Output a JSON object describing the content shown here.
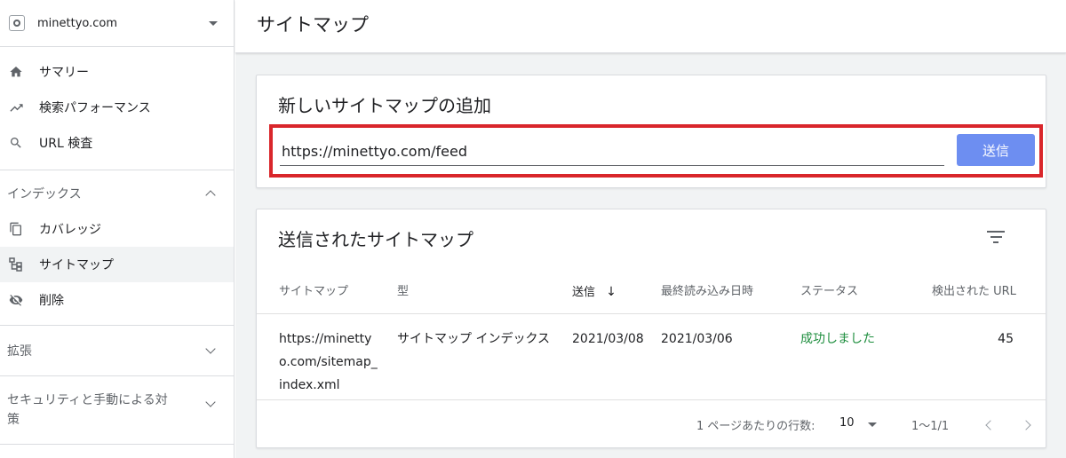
{
  "property": {
    "name": "minettyo.com"
  },
  "nav": {
    "items": [
      {
        "label": "サマリー",
        "icon": "home-icon"
      },
      {
        "label": "検索パフォーマンス",
        "icon": "trending-up-icon"
      },
      {
        "label": "URL 検査",
        "icon": "search-icon"
      }
    ],
    "index_group": {
      "label": "インデックス",
      "items": [
        {
          "label": "カバレッジ",
          "icon": "file-copy-icon"
        },
        {
          "label": "サイトマップ",
          "icon": "sitemap-icon"
        },
        {
          "label": "削除",
          "icon": "visibility-off-icon"
        }
      ]
    },
    "enhancements_group": {
      "label": "拡張"
    },
    "security_group": {
      "label": "セキュリティと手動による対策"
    }
  },
  "page": {
    "title": "サイトマップ"
  },
  "add_card": {
    "title": "新しいサイトマップの追加",
    "input_value": "https://minettyo.com/feed",
    "submit_label": "送信",
    "highlight_color": "#d9262b"
  },
  "submitted_card": {
    "title": "送信されたサイトマップ",
    "columns": [
      "サイトマップ",
      "型",
      "送信",
      "最終読み込み日時",
      "ステータス",
      "検出された URL"
    ],
    "sort_indicator": "↓",
    "rows": [
      {
        "sitemap": "https://minettyo.com/sitemap_index.xml",
        "type": "サイトマップ インデックス",
        "submitted": "2021/03/08",
        "last_read": "2021/03/06",
        "status": "成功しました",
        "urls": "45"
      }
    ],
    "pager": {
      "rows_label": "1 ページあたりの行数:",
      "rows_value": "10",
      "range": "1〜1/1"
    }
  },
  "colors": {
    "accent": "#6d8ef1",
    "status_success": "#1e8e3e"
  }
}
